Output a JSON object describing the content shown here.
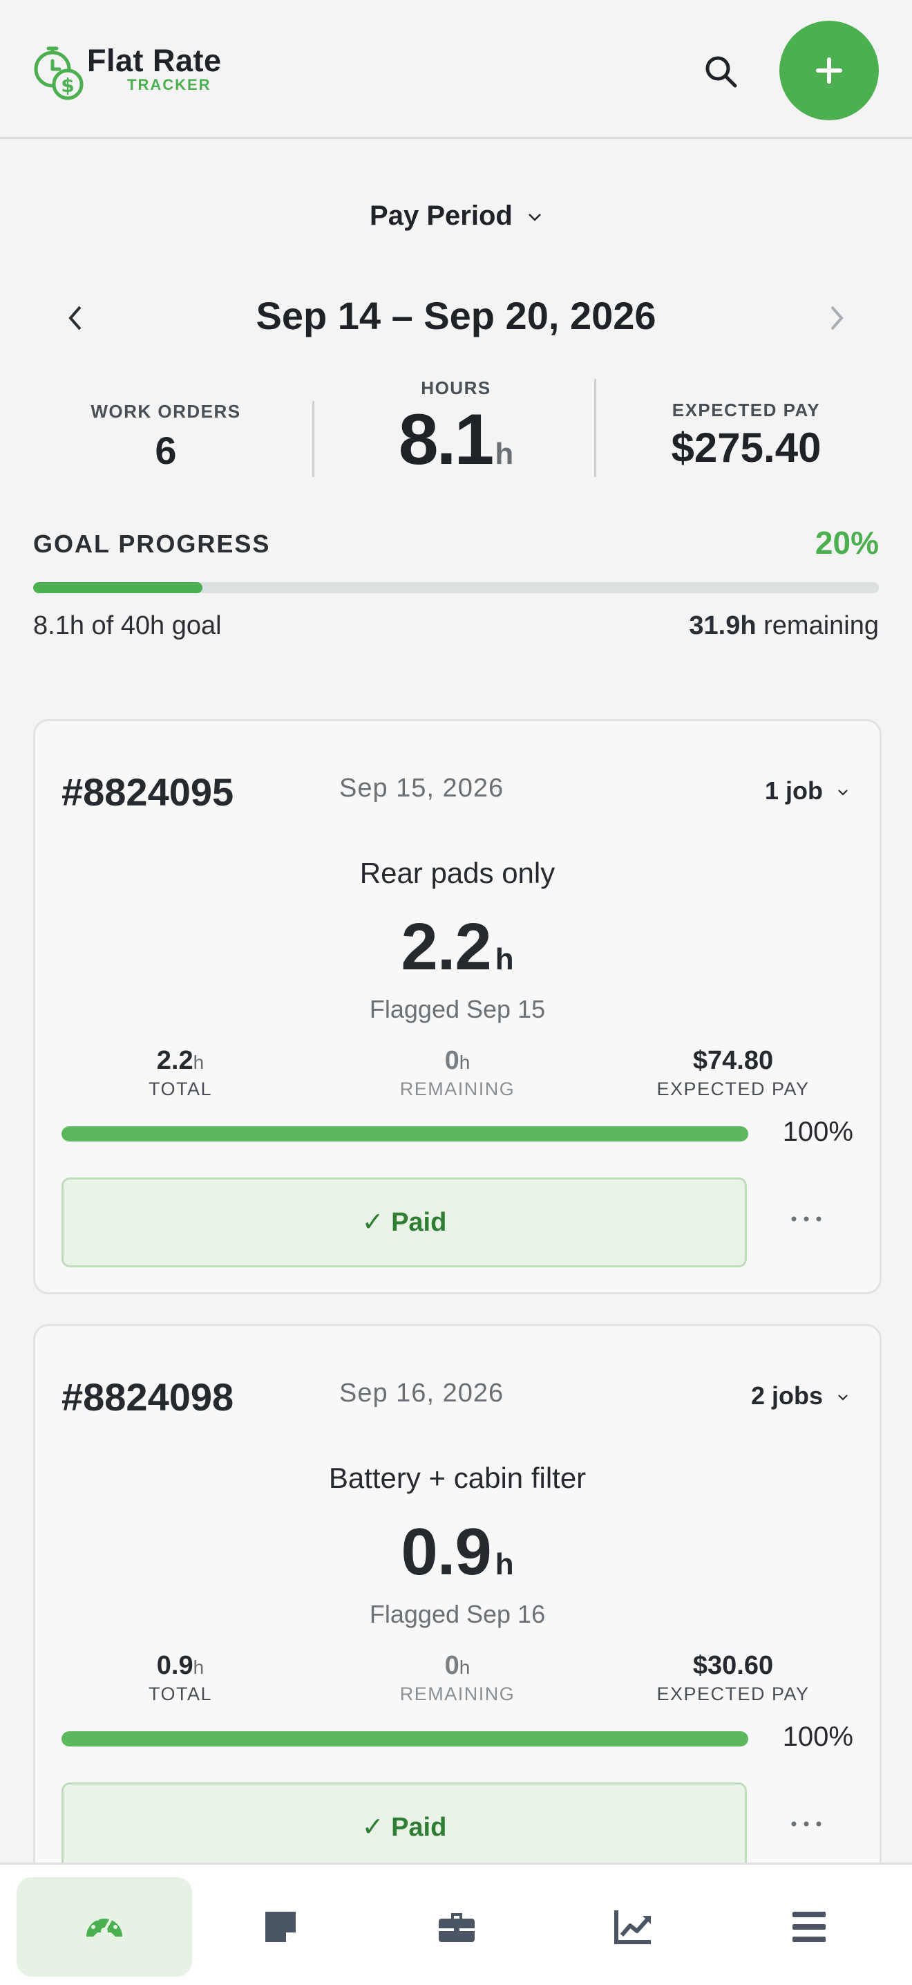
{
  "header": {
    "app_name": "Flat Rate",
    "app_sub": "TRACKER",
    "icons": [
      "stopwatch-dollar-logo",
      "search-icon",
      "plus-icon"
    ]
  },
  "period": {
    "selector_label": "Pay Period",
    "range": "Sep 14 – Sep 20, 2026"
  },
  "stats": {
    "work_orders_label": "WORK ORDERS",
    "work_orders_value": "6",
    "hours_label": "HOURS",
    "hours_value": "8.1",
    "hours_unit": "h",
    "pay_label": "EXPECTED PAY",
    "pay_value": "$275.40"
  },
  "goal": {
    "label": "GOAL PROGRESS",
    "percent_text": "20%",
    "progress": 0.2,
    "summary": "8.1h of 40h goal",
    "remaining_value": "31.9h",
    "remaining_label": "remaining"
  },
  "cards": [
    {
      "id": "#8824095",
      "date": "Sep 15, 2026",
      "jobs": "1 job",
      "description": "Rear pads only",
      "hours": "2.2",
      "unit": "h",
      "flagged": "Flagged Sep 15",
      "total_value": "2.2",
      "total_label": "TOTAL",
      "remaining_value": "0",
      "remaining_label": "REMAINING",
      "pay_value": "$74.80",
      "pay_label": "EXPECTED PAY",
      "progress": 1.0,
      "percent_text": "100%",
      "status": "✓ Paid"
    },
    {
      "id": "#8824098",
      "date": "Sep 16, 2026",
      "jobs": "2 jobs",
      "description": "Battery + cabin filter",
      "hours": "0.9",
      "unit": "h",
      "flagged": "Flagged Sep 16",
      "total_value": "0.9",
      "total_label": "TOTAL",
      "remaining_value": "0",
      "remaining_label": "REMAINING",
      "pay_value": "$30.60",
      "pay_label": "EXPECTED PAY",
      "progress": 1.0,
      "percent_text": "100%",
      "status": "✓ Paid"
    }
  ],
  "nav": {
    "items": [
      "dashboard-icon",
      "notes-icon",
      "jobs-icon",
      "reports-icon",
      "menu-icon"
    ],
    "active": "dashboard-icon"
  },
  "colors": {
    "accent": "#4caf50",
    "paid_bg": "#e9f3e7",
    "paid_text": "#2e7d32"
  }
}
